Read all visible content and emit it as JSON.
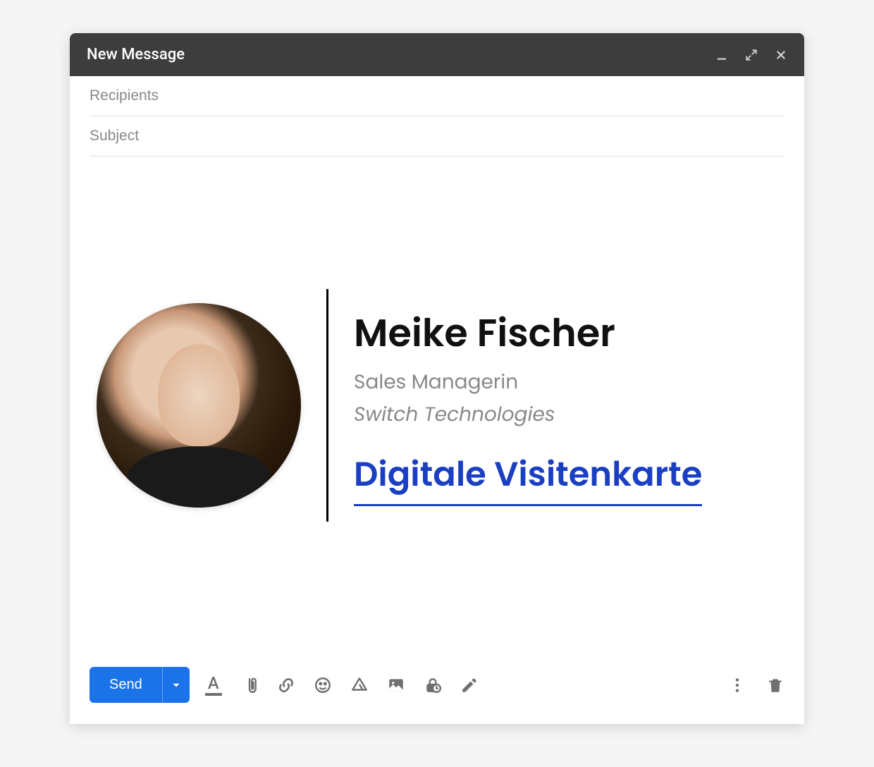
{
  "window": {
    "title": "New Message"
  },
  "fields": {
    "recipients_placeholder": "Recipients",
    "recipients_value": "",
    "subject_placeholder": "Subject",
    "subject_value": ""
  },
  "signature": {
    "name": "Meike Fischer",
    "role": "Sales Managerin",
    "company": "Switch Technologies",
    "link_text": "Digitale Visitenkarte"
  },
  "toolbar": {
    "send_label": "Send"
  },
  "icons": {
    "minimize": "minimize",
    "expand": "expand",
    "close": "close",
    "font": "A",
    "attach": "attach",
    "link": "link",
    "emoji": "emoji",
    "drive": "drive",
    "image": "image",
    "confidential": "confidential",
    "pen": "pen",
    "more": "more",
    "trash": "trash",
    "dropdown": "dropdown"
  },
  "colors": {
    "header_bg": "#3d3d3d",
    "primary": "#1a73e8",
    "link": "#1b3fc2",
    "icon": "#707070"
  }
}
